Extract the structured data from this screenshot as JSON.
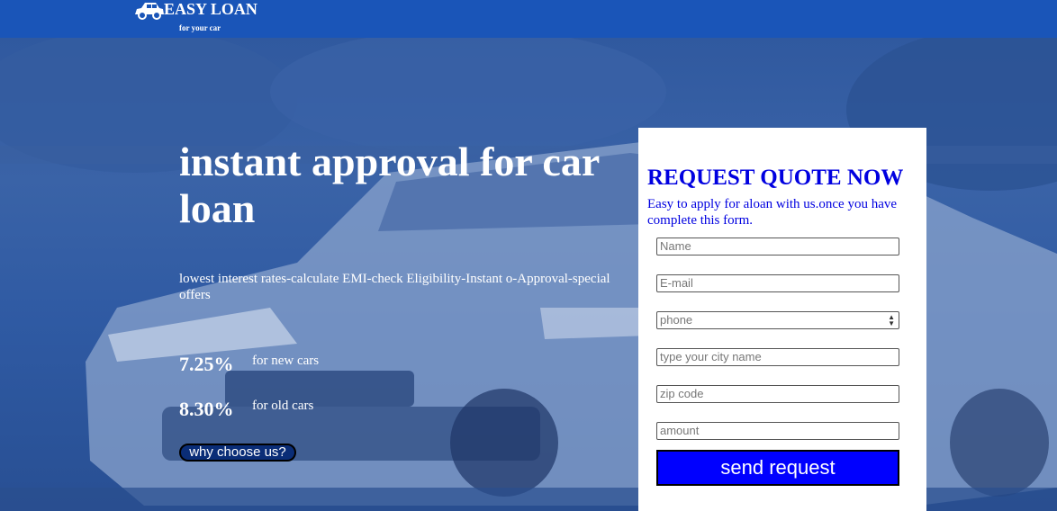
{
  "header": {
    "brand": "EASY LOAN",
    "tagline": "for your car",
    "logo_icon": "car-icon"
  },
  "hero": {
    "headline": "instant approval for car loan",
    "subline": "lowest interest rates-calculate EMI-check Eligibility-Instant o-Approval-special offers",
    "rates": [
      {
        "rate": "7.25%",
        "label": "for new cars"
      },
      {
        "rate": "8.30%",
        "label": "for old cars"
      }
    ],
    "why_button": "why choose us?"
  },
  "form": {
    "title": "REQUEST QUOTE NOW",
    "description": "Easy to apply for aloan with us.once you have complete this form.",
    "name_placeholder": "Name",
    "email_placeholder": "E-mail",
    "phone_value": "phone",
    "city_placeholder": "type your city name",
    "zip_placeholder": "zip code",
    "amount_placeholder": "amount",
    "submit_label": "send request"
  },
  "colors": {
    "header_bg": "#1a55b8",
    "form_accent": "#0000e0",
    "button_bg": "#0000ff"
  }
}
